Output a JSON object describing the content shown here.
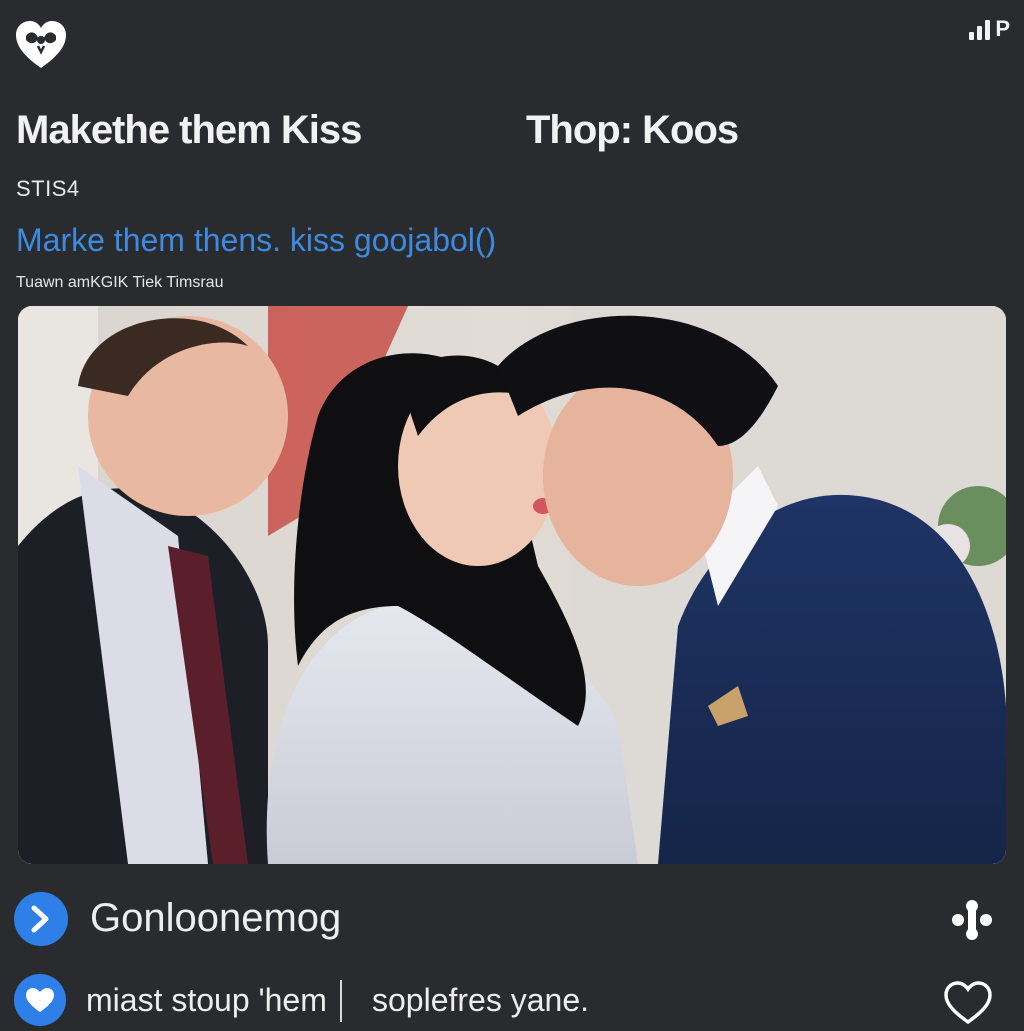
{
  "header": {
    "signal_label": "P"
  },
  "post": {
    "title": "Makethe them Kiss",
    "title_right": "Thop: Koos",
    "meta": "STIS4",
    "link": "Marke them thens. kiss goojabol()",
    "subtitle": "Tuawn amKGIK Tiek  Timsrau"
  },
  "actions": {
    "primary_label": "Gonloonemog",
    "secondary_label": "miast stoup 'hem",
    "secondary_label_right": "soplefres yane."
  },
  "colors": {
    "background": "#2a2b2f",
    "accent": "#2e7fe8",
    "link": "#3d8be0"
  },
  "icons": {
    "logo": "heart-logo-icon",
    "signal": "signal-icon",
    "primary": "chevron-right-icon",
    "more": "more-options-icon",
    "secondary": "heart-icon",
    "like": "heart-outline-icon"
  }
}
